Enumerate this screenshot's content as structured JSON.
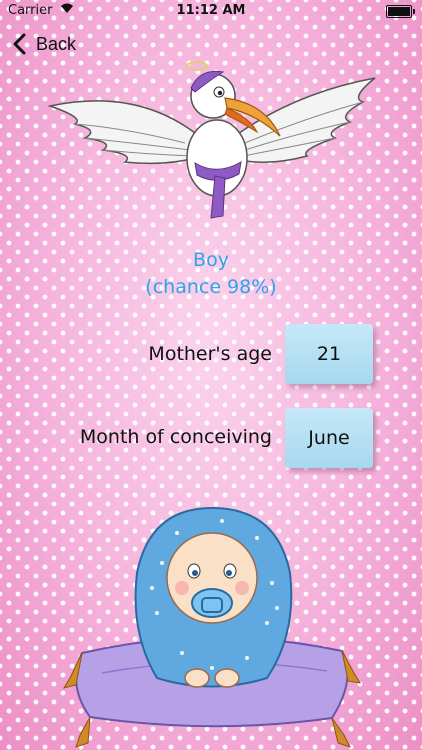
{
  "status": {
    "carrier": "Carrier",
    "time": "11:12 AM"
  },
  "nav": {
    "back_label": "Back"
  },
  "result": {
    "gender": "Boy",
    "chance": "(chance 98%)"
  },
  "form": {
    "mother_age_label": "Mother's age",
    "mother_age_value": "21",
    "month_label": "Month of conceiving",
    "month_value": "June"
  },
  "colors": {
    "accent": "#2ea4ea",
    "background": "#f2a7d3",
    "button": "#b3dff2"
  }
}
